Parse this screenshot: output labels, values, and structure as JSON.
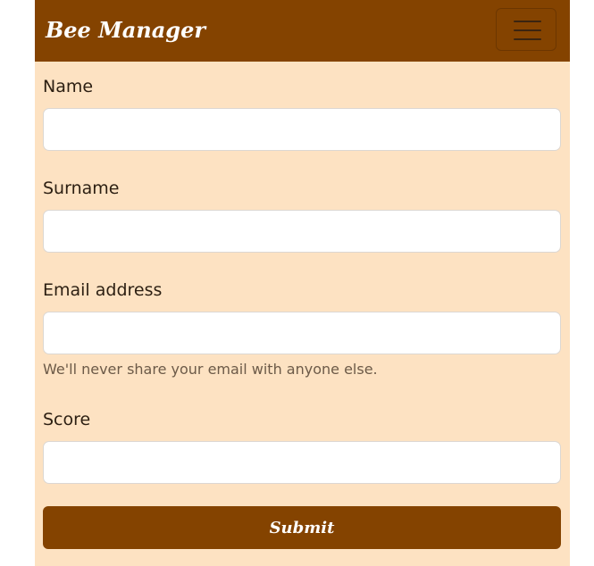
{
  "navbar": {
    "brand": "Bee Manager",
    "toggle_icon": "hamburger-menu-icon"
  },
  "form": {
    "fields": [
      {
        "label": "Name",
        "value": "",
        "type": "text"
      },
      {
        "label": "Surname",
        "value": "",
        "type": "text"
      },
      {
        "label": "Email address",
        "value": "",
        "type": "email",
        "help": "We'll never share your email with anyone else."
      },
      {
        "label": "Score",
        "value": "",
        "type": "number"
      }
    ],
    "submit_label": "Submit"
  },
  "colors": {
    "brand_brown": "#844300",
    "background_peach": "#fde2c2",
    "input_bg": "#ffffff"
  }
}
